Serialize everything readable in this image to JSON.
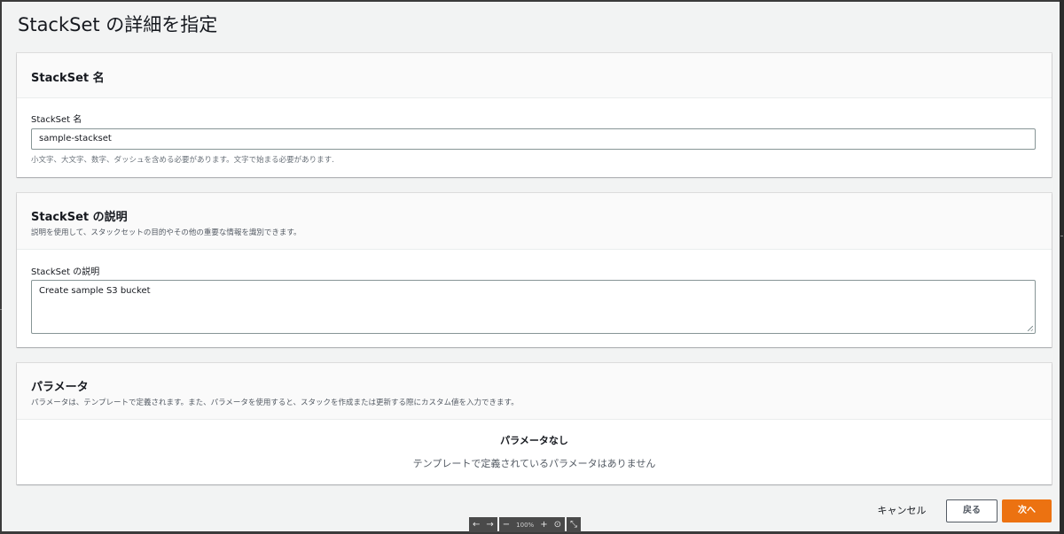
{
  "page": {
    "title": "StackSet の詳細を指定"
  },
  "name_panel": {
    "header": "StackSet 名",
    "label": "StackSet 名",
    "value": "sample-stackset",
    "hint": "小文字、大文字、数字、ダッシュを含める必要があります。文字で始まる必要があります."
  },
  "desc_panel": {
    "header": "StackSet の説明",
    "description": "説明を使用して、スタックセットの目的やその他の重要な情報を識別できます。",
    "label": "StackSet の説明",
    "value": "Create sample S3 bucket"
  },
  "params_panel": {
    "header": "パラメータ",
    "description": "パラメータは、テンプレートで定義されます。また、パラメータを使用すると、スタックを作成または更新する際にカスタム値を入力できます。",
    "empty_title": "パラメータなし",
    "empty_desc": "テンプレートで定義されているパラメータはありません"
  },
  "footer": {
    "cancel": "キャンセル",
    "back": "戻る",
    "next": "次へ"
  },
  "zoom_bar": {
    "back_arrow": "←",
    "forward_arrow": "→",
    "zoom_out": "−",
    "zoom_level": "100%",
    "zoom_in": "+",
    "reset_icon": "⊙",
    "fit_icon": "⤡"
  },
  "colors": {
    "primary": "#ec7211",
    "background": "#f2f3f3",
    "panel_header": "#fafafa"
  }
}
